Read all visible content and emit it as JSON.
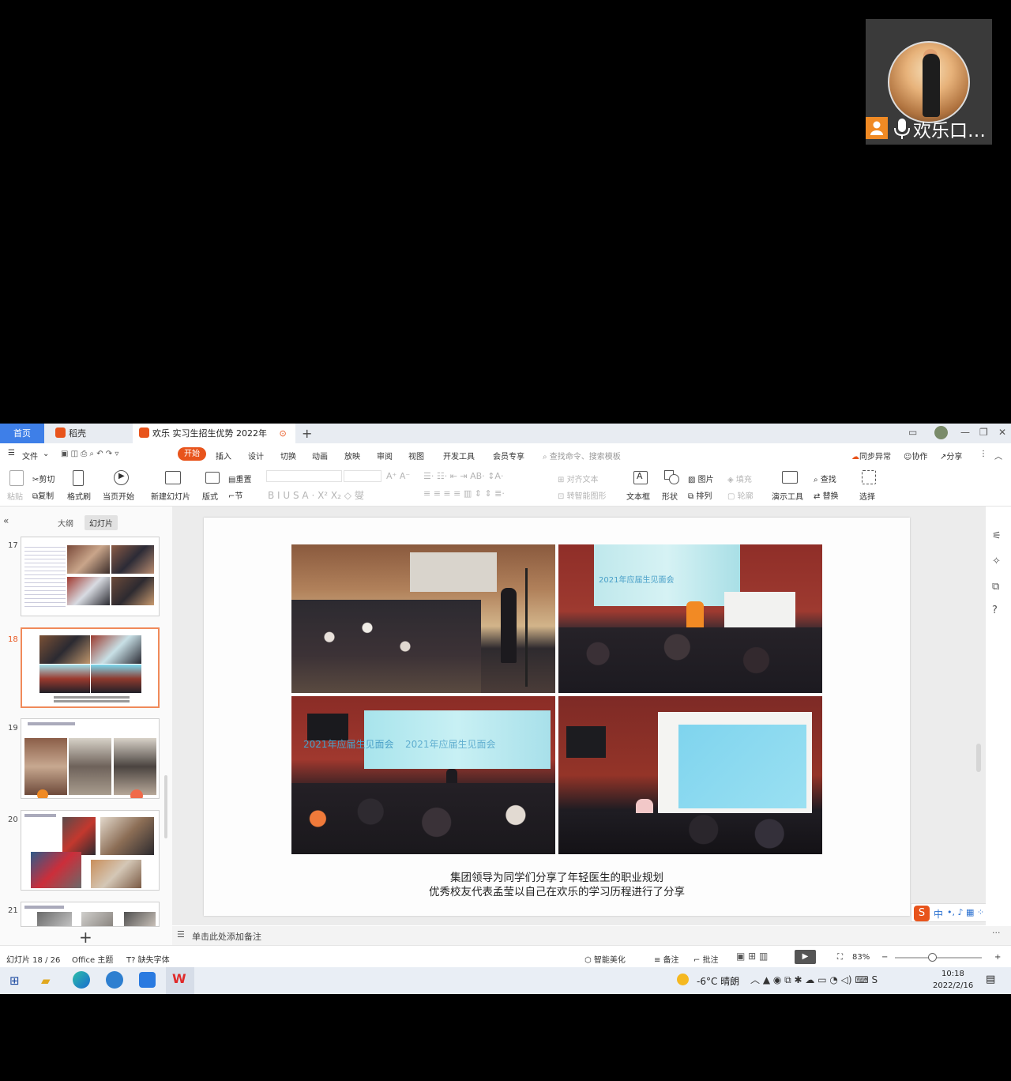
{
  "video": {
    "user_name": "欢乐口…"
  },
  "tabs": {
    "home": "首页",
    "daoke": "稻壳",
    "doc": "欢乐 实习生招生优势 2022年",
    "plus": "+"
  },
  "menu": [
    "文件",
    "开始",
    "插入",
    "设计",
    "切换",
    "动画",
    "放映",
    "审阅",
    "视图",
    "开发工具",
    "会员专享"
  ],
  "menu_search": "查找命令、搜索模板",
  "menu_right": {
    "sync": "同步异常",
    "collab": "协作",
    "share": "分享"
  },
  "ribbon": {
    "paste": "粘贴",
    "cut": "剪切",
    "copy": "复制",
    "format_painter": "格式刷",
    "from_current": "当页开始",
    "new_slide": "新建幻灯片",
    "layout": "版式",
    "reset": "重置",
    "section": "节",
    "align_text": "对齐文本",
    "smart_graphic": "转智能图形",
    "textbox": "文本框",
    "shape": "形状",
    "picture": "图片",
    "arrange": "排列",
    "fill": "填充",
    "outline": "轮廓",
    "presenter_tools": "演示工具",
    "find": "查找",
    "replace": "替换",
    "select": "选择"
  },
  "sidebar": {
    "outline_tab": "大纲",
    "slides_tab": "幻灯片",
    "slide_numbers": [
      "17",
      "18",
      "19",
      "20",
      "21"
    ],
    "add": "+"
  },
  "slide": {
    "photo_titles": [
      "2021年应届生见面会",
      "2021年应届生见面会"
    ],
    "caption_line1": "集团领导为同学们分享了年轻医生的职业规划",
    "caption_line2": "优秀校友代表孟莹以自己在欢乐的学习历程进行了分享"
  },
  "notes_placeholder": "单击此处添加备注",
  "ime": {
    "lang": "中"
  },
  "status": {
    "slide_count": "幻灯片 18 / 26",
    "theme": "Office 主题",
    "missing_font": "缺失字体",
    "smart_beautify": "智能美化",
    "notes": "备注",
    "comments": "批注",
    "zoom": "83%"
  },
  "taskbar": {
    "weather": "-6°C  晴朗",
    "time": "10:18",
    "date": "2022/2/16"
  }
}
